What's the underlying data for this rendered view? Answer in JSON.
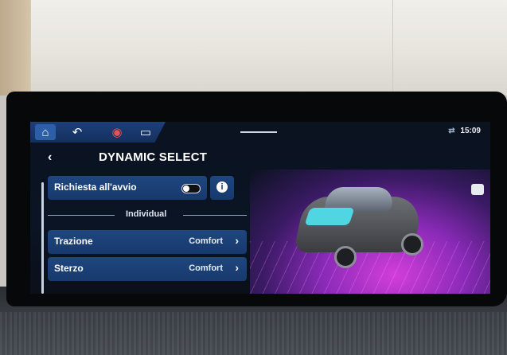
{
  "status_bar": {
    "signal_icon": "signal-icon",
    "time": "15:09"
  },
  "title": "DYNAMIC SELECT",
  "settings": {
    "startup_label": "Richiesta all'avvio",
    "startup_enabled": false,
    "section_label": "Individual",
    "rows": [
      {
        "label": "Trazione",
        "value": "Comfort"
      },
      {
        "label": "Sterzo",
        "value": "Comfort"
      }
    ]
  },
  "icons": {
    "home": "home-icon",
    "back": "back-icon",
    "drive": "dynamic-select-icon",
    "car": "car-icon",
    "info": "info-icon",
    "chevron": "chevron-right-icon"
  },
  "colors": {
    "accent": "#1f4680",
    "highlight": "#4fe3ef",
    "ambient": "#d23ed8"
  }
}
